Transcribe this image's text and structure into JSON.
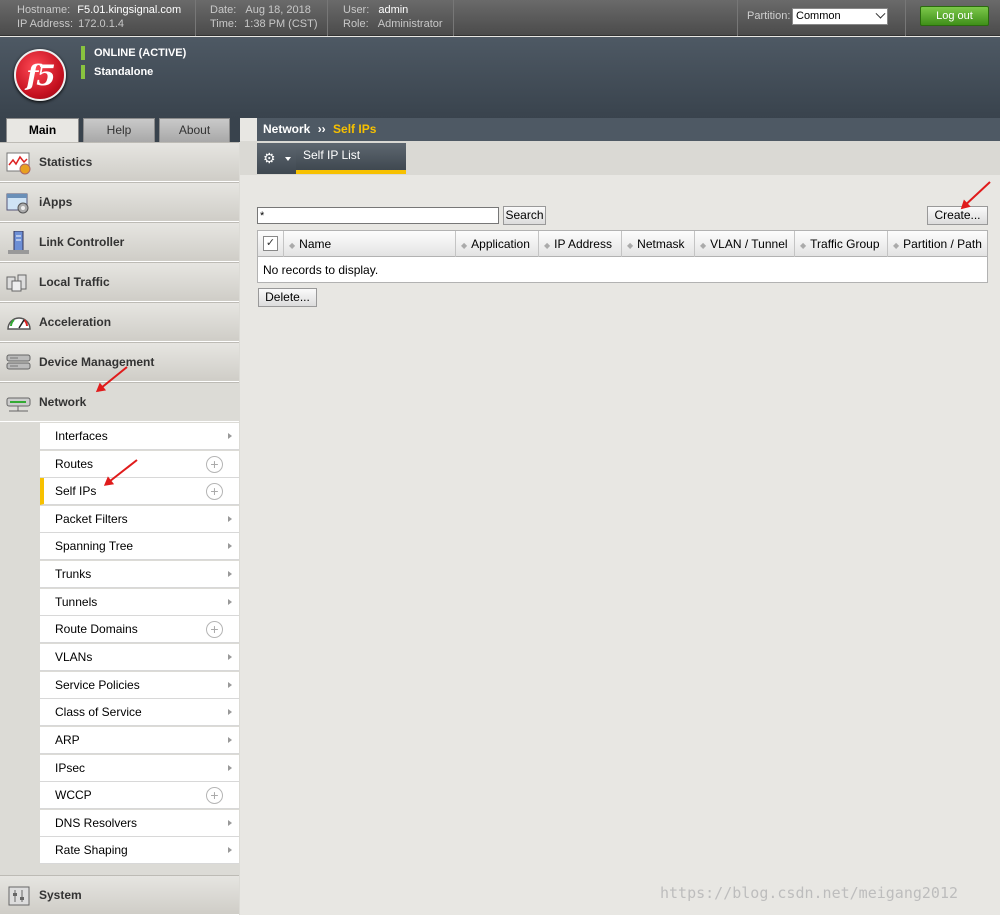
{
  "topbar": {
    "hostname_label": "Hostname:",
    "hostname": "F5.01.kingsignal.com",
    "ip_label": "IP Address:",
    "ip": "172.0.1.4",
    "date_label": "Date:",
    "date": "Aug 18, 2018",
    "time_label": "Time:",
    "time": "1:38 PM (CST)",
    "user_label": "User:",
    "user": "admin",
    "role_label": "Role:",
    "role": "Administrator",
    "partition_label": "Partition:",
    "partition_value": "Common",
    "logout_label": "Log out"
  },
  "header": {
    "logo_text": "f5",
    "status_online": "ONLINE (ACTIVE)",
    "status_mode": "Standalone",
    "status_color": "#89c33f"
  },
  "tabs": [
    "Main",
    "Help",
    "About"
  ],
  "sidebar": {
    "categories": [
      {
        "label": "Statistics",
        "icon": "statistics-icon"
      },
      {
        "label": "iApps",
        "icon": "iapps-icon"
      },
      {
        "label": "Link Controller",
        "icon": "link-controller-icon"
      },
      {
        "label": "Local Traffic",
        "icon": "local-traffic-icon"
      },
      {
        "label": "Acceleration",
        "icon": "acceleration-icon"
      },
      {
        "label": "Device Management",
        "icon": "device-management-icon"
      },
      {
        "label": "Network",
        "icon": "network-icon"
      }
    ],
    "network_items": [
      {
        "label": "Interfaces",
        "action": "chevron"
      },
      {
        "label": "Routes",
        "action": "plus"
      },
      {
        "label": "Self IPs",
        "action": "plus",
        "selected": true
      },
      {
        "label": "Packet Filters",
        "action": "chevron"
      },
      {
        "label": "Spanning Tree",
        "action": "chevron"
      },
      {
        "label": "Trunks",
        "action": "chevron"
      },
      {
        "label": "Tunnels",
        "action": "chevron"
      },
      {
        "label": "Route Domains",
        "action": "plus"
      },
      {
        "label": "VLANs",
        "action": "chevron"
      },
      {
        "label": "Service Policies",
        "action": "chevron"
      },
      {
        "label": "Class of Service",
        "action": "chevron"
      },
      {
        "label": "ARP",
        "action": "chevron"
      },
      {
        "label": "IPsec",
        "action": "chevron"
      },
      {
        "label": "WCCP",
        "action": "plus"
      },
      {
        "label": "DNS Resolvers",
        "action": "chevron"
      },
      {
        "label": "Rate Shaping",
        "action": "chevron"
      }
    ],
    "system_label": "System"
  },
  "breadcrumb": {
    "section": "Network",
    "separator": "››",
    "current": "Self IPs"
  },
  "subnav": {
    "tab_label": "Self IP List"
  },
  "search": {
    "value": "*",
    "button_label": "Search"
  },
  "actions": {
    "create_label": "Create...",
    "delete_label": "Delete..."
  },
  "table": {
    "columns": [
      "Name",
      "Application",
      "IP Address",
      "Netmask",
      "VLAN / Tunnel",
      "Traffic Group",
      "Partition / Path"
    ],
    "empty_message": "No records to display."
  },
  "watermark": "https://blog.csdn.net/meigang2012",
  "colors": {
    "accent": "#f7c100",
    "annotation_arrow": "#e01b1b",
    "logout_green": "#3f8f19"
  }
}
